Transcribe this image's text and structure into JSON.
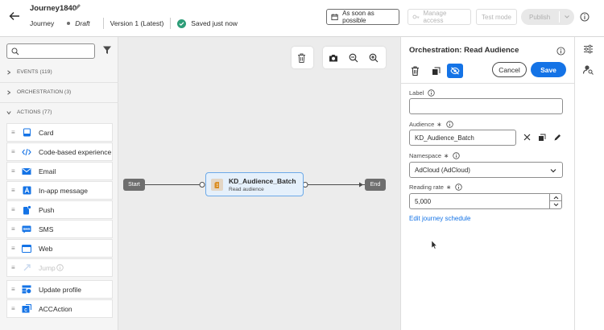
{
  "header": {
    "title": "Journey1840",
    "breadcrumb": "Journey",
    "status": "Draft",
    "version": "Version 1 (Latest)",
    "saved": "Saved just now",
    "schedule_label": "As soon as possible",
    "manage_access_label": "Manage access",
    "test_mode_label": "Test mode",
    "publish_label": "Publish"
  },
  "left": {
    "search_placeholder": "",
    "events_label": "EVENTS (119)",
    "orchestration_label": "ORCHESTRATION (3)",
    "actions_label": "ACTIONS (77)",
    "actions": [
      {
        "label": "Card",
        "icon": "card-icon"
      },
      {
        "label": "Code-based experience",
        "icon": "code-icon"
      },
      {
        "label": "Email",
        "icon": "email-icon"
      },
      {
        "label": "In-app message",
        "icon": "in-app-icon"
      },
      {
        "label": "Push",
        "icon": "push-icon"
      },
      {
        "label": "SMS",
        "icon": "sms-icon"
      },
      {
        "label": "Web",
        "icon": "web-icon"
      },
      {
        "label": "Jump",
        "icon": "jump-icon",
        "disabled": true
      },
      {
        "label": "Update profile",
        "icon": "update-profile-icon"
      },
      {
        "label": "ACCAction",
        "icon": "acc-icon"
      }
    ]
  },
  "canvas": {
    "start_label": "Start",
    "end_label": "End",
    "node_title": "KD_Audience_Batch",
    "node_subtitle": "Read audience"
  },
  "panel": {
    "title": "Orchestration: Read Audience",
    "cancel_label": "Cancel",
    "save_label": "Save",
    "label_field_label": "Label",
    "label_value": "",
    "audience_label": "Audience",
    "audience_value": "KD_Audience_Batch",
    "namespace_label": "Namespace",
    "namespace_value": "AdCloud (AdCloud)",
    "reading_rate_label": "Reading rate",
    "reading_rate_value": "5,000",
    "schedule_link": "Edit journey schedule"
  },
  "colors": {
    "accent": "#1473e6",
    "node_fill": "#e5f0fb",
    "canvas_bg": "#ececec"
  }
}
